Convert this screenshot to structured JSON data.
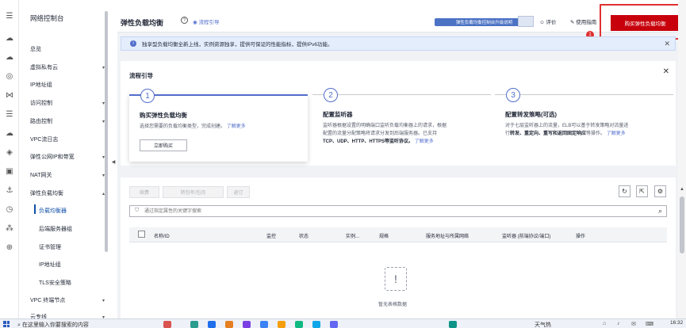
{
  "sidebar": {
    "title": "网络控制台",
    "items": [
      {
        "label": "总览",
        "arrow": ""
      },
      {
        "label": "虚拟私有云",
        "arrow": "▾"
      },
      {
        "label": "IP地址组",
        "arrow": ""
      },
      {
        "label": "访问控制",
        "arrow": "▾"
      },
      {
        "label": "路由控制",
        "arrow": "▾"
      },
      {
        "label": "VPC流日志",
        "arrow": ""
      },
      {
        "label": "弹性公网IP和带宽",
        "arrow": "▾"
      },
      {
        "label": "NAT网关",
        "arrow": "▾"
      },
      {
        "label": "弹性负载均衡",
        "arrow": "▴"
      }
    ],
    "sub_items": [
      {
        "label": "负载均衡器",
        "active": true
      },
      {
        "label": "后端服务器组",
        "active": false
      },
      {
        "label": "证书管理",
        "active": false
      },
      {
        "label": "IP地址组",
        "active": false
      },
      {
        "label": "TLS安全策略",
        "active": false
      }
    ],
    "bottom_items": [
      {
        "label": "VPC 终端节点",
        "arrow": "▾"
      },
      {
        "label": "云专线",
        "arrow": "▾"
      }
    ]
  },
  "header": {
    "title": "弹性负载均衡",
    "help_icon": "question-circle-icon",
    "flow_link": "流程引导",
    "banner_text": "弹性负载均衡控制台升级说明",
    "eval_label": "评价",
    "guide_label": "使用指南",
    "buy_button": "购买弹性负载均衡",
    "badge": "1"
  },
  "info_bar": {
    "text": "独享型负载均衡全新上线，实例资源独享，提供可保证的性能指标，提供IPv6功能。"
  },
  "flow_guide": {
    "title": "流程引导",
    "steps": [
      {
        "num": "1",
        "title": "购买弹性负载均衡",
        "desc": "选择您需要的负载均衡类型，完成创建。",
        "link": "了解更多",
        "button": "立即购买"
      },
      {
        "num": "2",
        "title": "配置监听器",
        "desc_lines": [
          "监听器根据设置的明确端口监听负载均衡器上的请求，根据",
          "配置的流量分配策略将请求分发到后端服务器。已支持"
        ],
        "protocols": "TCP、UDP、HTTP、HTTPS等监听协议。",
        "link": "了解更多"
      },
      {
        "num": "3",
        "title": "配置转发策略(可选)",
        "desc_lines": [
          "对于七层监听器上的流量，ELB可以基于转发策略对流量进"
        ],
        "desc_prefix": "行",
        "desc_bold": "转发、重定向、重写和返回固定响应",
        "desc_suffix": "等操作。",
        "link": "了解更多"
      }
    ]
  },
  "list": {
    "buttons": [
      "续费",
      "转包年/包月",
      "退订"
    ],
    "tool_icons": [
      "refresh-icon",
      "export-icon",
      "settings-icon"
    ],
    "search_placeholder": "通过指定属性的关键字搜索",
    "columns": [
      "名称/ID",
      "监控",
      "状态",
      "规格",
      "服务地址与所属网络",
      "监听器 (前端协议/端口)",
      "操作"
    ],
    "instance_header": "实例...",
    "empty_text": "暂无表格数据"
  },
  "taskbar": {
    "search_text": "在这里输入你要搜索的内容",
    "weather": "天气热",
    "time": "16:32",
    "app_colors": [
      "#d9534f",
      "#2a9d8f",
      "#1f6feb",
      "#e67e22",
      "#7b3fe4",
      "#3b82f6",
      "#f59e0b",
      "#10b981",
      "#0ea5e9",
      "#6366f1",
      "#0d9488"
    ]
  },
  "colors": {
    "accent": "#526ecc",
    "buy_red": "#c7000b",
    "highlight": "#e03030"
  }
}
